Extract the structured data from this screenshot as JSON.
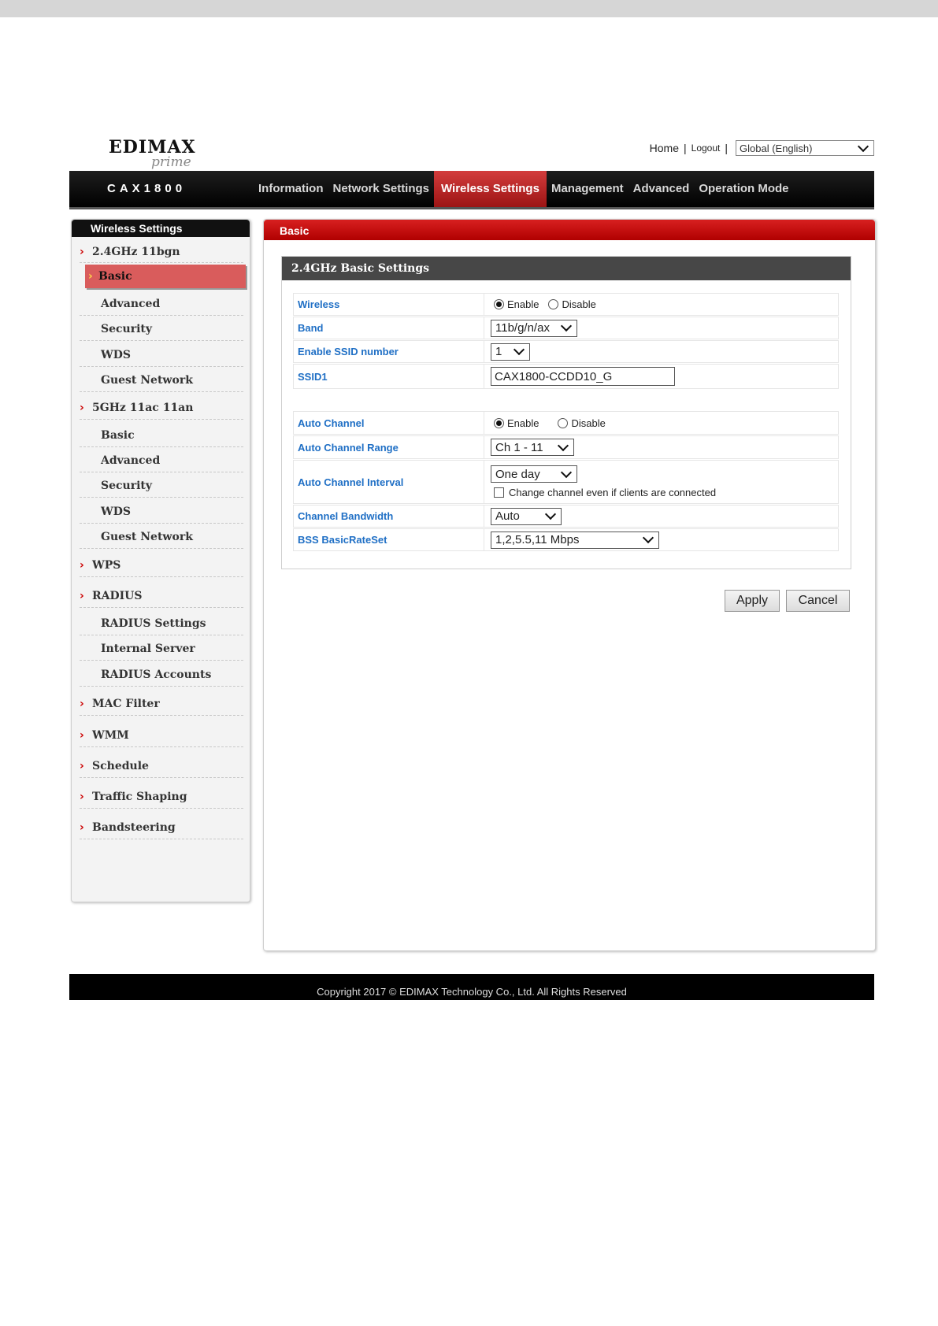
{
  "header": {
    "logo_text": "EDIMAX",
    "logo_sub": "prime",
    "home_link": "Home",
    "logout_link": "Logout",
    "language": "Global (English)"
  },
  "nav": {
    "model": "CAX1800",
    "items": [
      "Information",
      "Network Settings",
      "Wireless Settings",
      "Management",
      "Advanced",
      "Operation Mode"
    ],
    "active": "Wireless Settings"
  },
  "sidebar": {
    "title": "Wireless Settings",
    "items": [
      {
        "label": "2.4GHz 11bgn",
        "level": 1
      },
      {
        "label": "Basic",
        "level": 2,
        "active": true
      },
      {
        "label": "Advanced",
        "level": 2
      },
      {
        "label": "Security",
        "level": 2
      },
      {
        "label": "WDS",
        "level": 2
      },
      {
        "label": "Guest Network",
        "level": 2
      },
      {
        "label": "5GHz 11ac 11an",
        "level": 1
      },
      {
        "label": "Basic",
        "level": 2
      },
      {
        "label": "Advanced",
        "level": 2
      },
      {
        "label": "Security",
        "level": 2
      },
      {
        "label": "WDS",
        "level": 2
      },
      {
        "label": "Guest Network",
        "level": 2
      },
      {
        "label": "WPS",
        "level": 1
      },
      {
        "label": "RADIUS",
        "level": 1
      },
      {
        "label": "RADIUS Settings",
        "level": 2
      },
      {
        "label": "Internal Server",
        "level": 2
      },
      {
        "label": "RADIUS Accounts",
        "level": 2
      },
      {
        "label": "MAC Filter",
        "level": 1
      },
      {
        "label": "WMM",
        "level": 1
      },
      {
        "label": "Schedule",
        "level": 1
      },
      {
        "label": "Traffic Shaping",
        "level": 1
      },
      {
        "label": "Bandsteering",
        "level": 1
      }
    ]
  },
  "content": {
    "title": "Basic",
    "panel_title": "2.4GHz Basic Settings",
    "fields": {
      "wireless": {
        "label": "Wireless",
        "enable": "Enable",
        "disable": "Disable",
        "value": "Enable"
      },
      "band": {
        "label": "Band",
        "value": "11b/g/n/ax"
      },
      "ssid_number": {
        "label": "Enable SSID number",
        "value": "1"
      },
      "ssid1": {
        "label": "SSID1",
        "value": "CAX1800-CCDD10_G"
      },
      "auto_channel": {
        "label": "Auto Channel",
        "enable": "Enable",
        "disable": "Disable",
        "value": "Enable"
      },
      "auto_channel_range": {
        "label": "Auto Channel Range",
        "value": "Ch 1 - 11"
      },
      "auto_channel_interval": {
        "label": "Auto Channel Interval",
        "value": "One day",
        "checkbox_label": "Change channel even if clients are connected",
        "checkbox_checked": false
      },
      "channel_bandwidth": {
        "label": "Channel Bandwidth",
        "value": "Auto"
      },
      "bss_basic_rate_set": {
        "label": "BSS BasicRateSet",
        "value": "1,2,5.5,11 Mbps"
      }
    },
    "apply_label": "Apply",
    "cancel_label": "Cancel"
  },
  "footer": {
    "copyright": "Copyright 2017 © EDIMAX Technology Co., Ltd. All Rights Reserved"
  }
}
